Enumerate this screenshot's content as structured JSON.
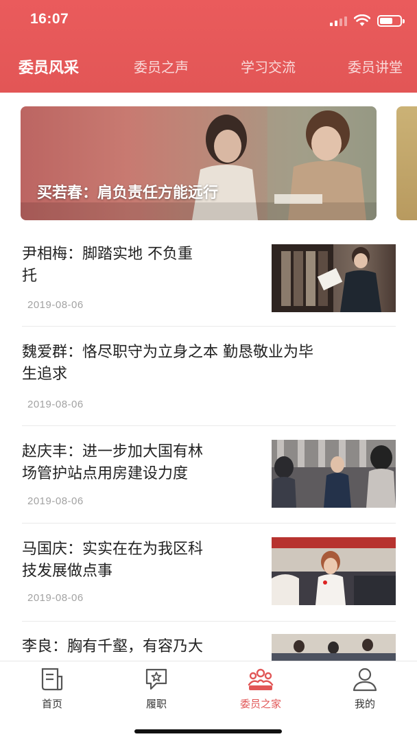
{
  "status_bar": {
    "time": "16:07"
  },
  "top_tabs": [
    {
      "label": "委员风采",
      "active": true
    },
    {
      "label": "委员之声",
      "active": false
    },
    {
      "label": "学习交流",
      "active": false
    },
    {
      "label": "委员讲堂",
      "active": false
    }
  ],
  "banner": {
    "caption": "买若春：肩负责任方能远行"
  },
  "news": [
    {
      "title_line1": "尹相梅：脚踏实地  不负重",
      "title_line2": "托",
      "date": "2019-08-06"
    },
    {
      "title_line1": "魏爱群：恪尽职守为立身之本  勤恳敬业为毕",
      "title_line2": "生追求",
      "date": "2019-08-06"
    },
    {
      "title_line1": "赵庆丰：进一步加大国有林",
      "title_line2": "场管护站点用房建设力度",
      "date": "2019-08-06"
    },
    {
      "title_line1": "马国庆：实实在在为我区科",
      "title_line2": "技发展做点事",
      "date": "2019-08-06"
    },
    {
      "title_line1": "李良：胸有千壑，有容乃大",
      "title_line2": "",
      "date": ""
    }
  ],
  "tabbar": [
    {
      "label": "首页",
      "icon": "home-document-icon",
      "active": false
    },
    {
      "label": "履职",
      "icon": "duty-flag-icon",
      "active": false
    },
    {
      "label": "委员之家",
      "icon": "members-group-icon",
      "active": true
    },
    {
      "label": "我的",
      "icon": "profile-user-icon",
      "active": false
    }
  ],
  "colors": {
    "accent": "#e15656",
    "header": "#ea5b5c",
    "text": "#222222",
    "date": "#a2a2a2"
  }
}
